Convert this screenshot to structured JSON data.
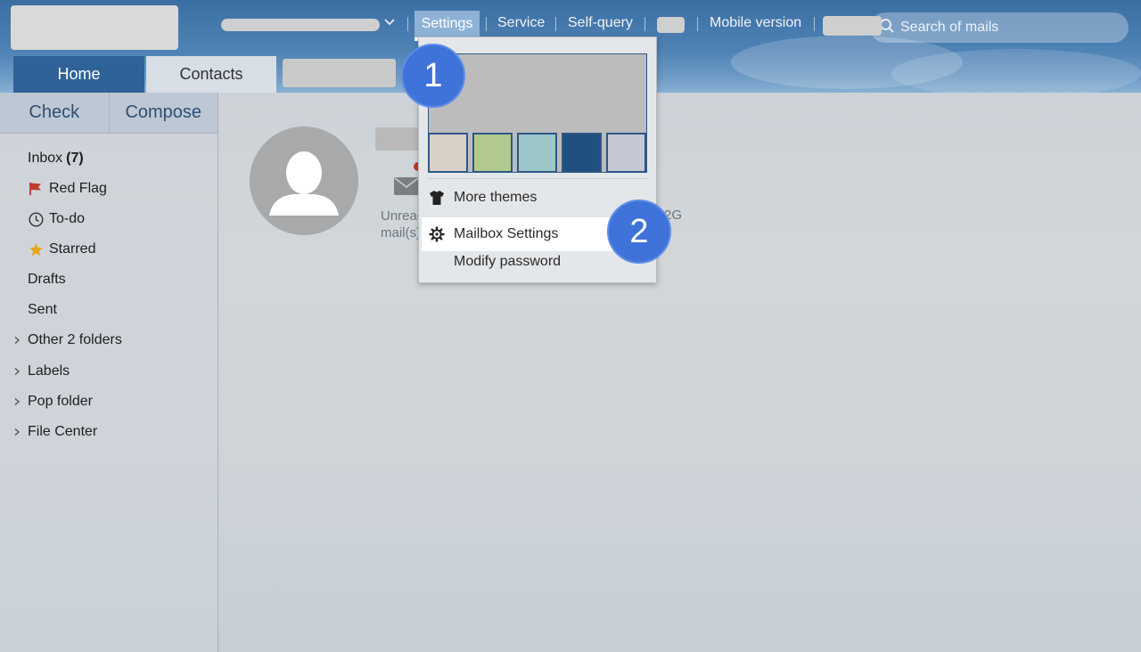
{
  "header": {
    "nav": {
      "settings": "Settings",
      "service": "Service",
      "self_query": "Self-query",
      "mobile_version": "Mobile version"
    },
    "search": {
      "placeholder": "Search of mails",
      "icon": "search-icon"
    },
    "tabs": [
      {
        "label": "Home",
        "active": true
      },
      {
        "label": "Contacts",
        "active": false
      }
    ]
  },
  "sidebar": {
    "check_label": "Check",
    "compose_label": "Compose",
    "inbox": {
      "label": "Inbox",
      "count": "(7)"
    },
    "items": [
      {
        "label": "Red Flag",
        "icon": "red-flag-icon"
      },
      {
        "label": "To-do",
        "icon": "clock-icon"
      },
      {
        "label": "Starred",
        "icon": "star-icon"
      },
      {
        "label": "Drafts"
      },
      {
        "label": "Sent"
      }
    ],
    "folders": [
      {
        "label": "Other 2 folders"
      },
      {
        "label": "Labels"
      },
      {
        "label": "Pop folder"
      },
      {
        "label": "File Center"
      }
    ]
  },
  "main": {
    "unread_line1": "Unread",
    "unread_line2": "mail(s)",
    "quota_text": "2G"
  },
  "dropdown": {
    "more_themes": "More themes",
    "mailbox_settings": "Mailbox Settings",
    "modify_password": "Modify password",
    "swatches": [
      "#d9d0c8",
      "#b2c98d",
      "#9cc6c8",
      "#22507e",
      "#c3c8d2"
    ]
  },
  "badges": {
    "one": "1",
    "two": "2"
  },
  "colors": {
    "accent": "#2e6299",
    "badge": "#3f73d9",
    "flag": "#c0392b",
    "star": "#e8a51c"
  }
}
